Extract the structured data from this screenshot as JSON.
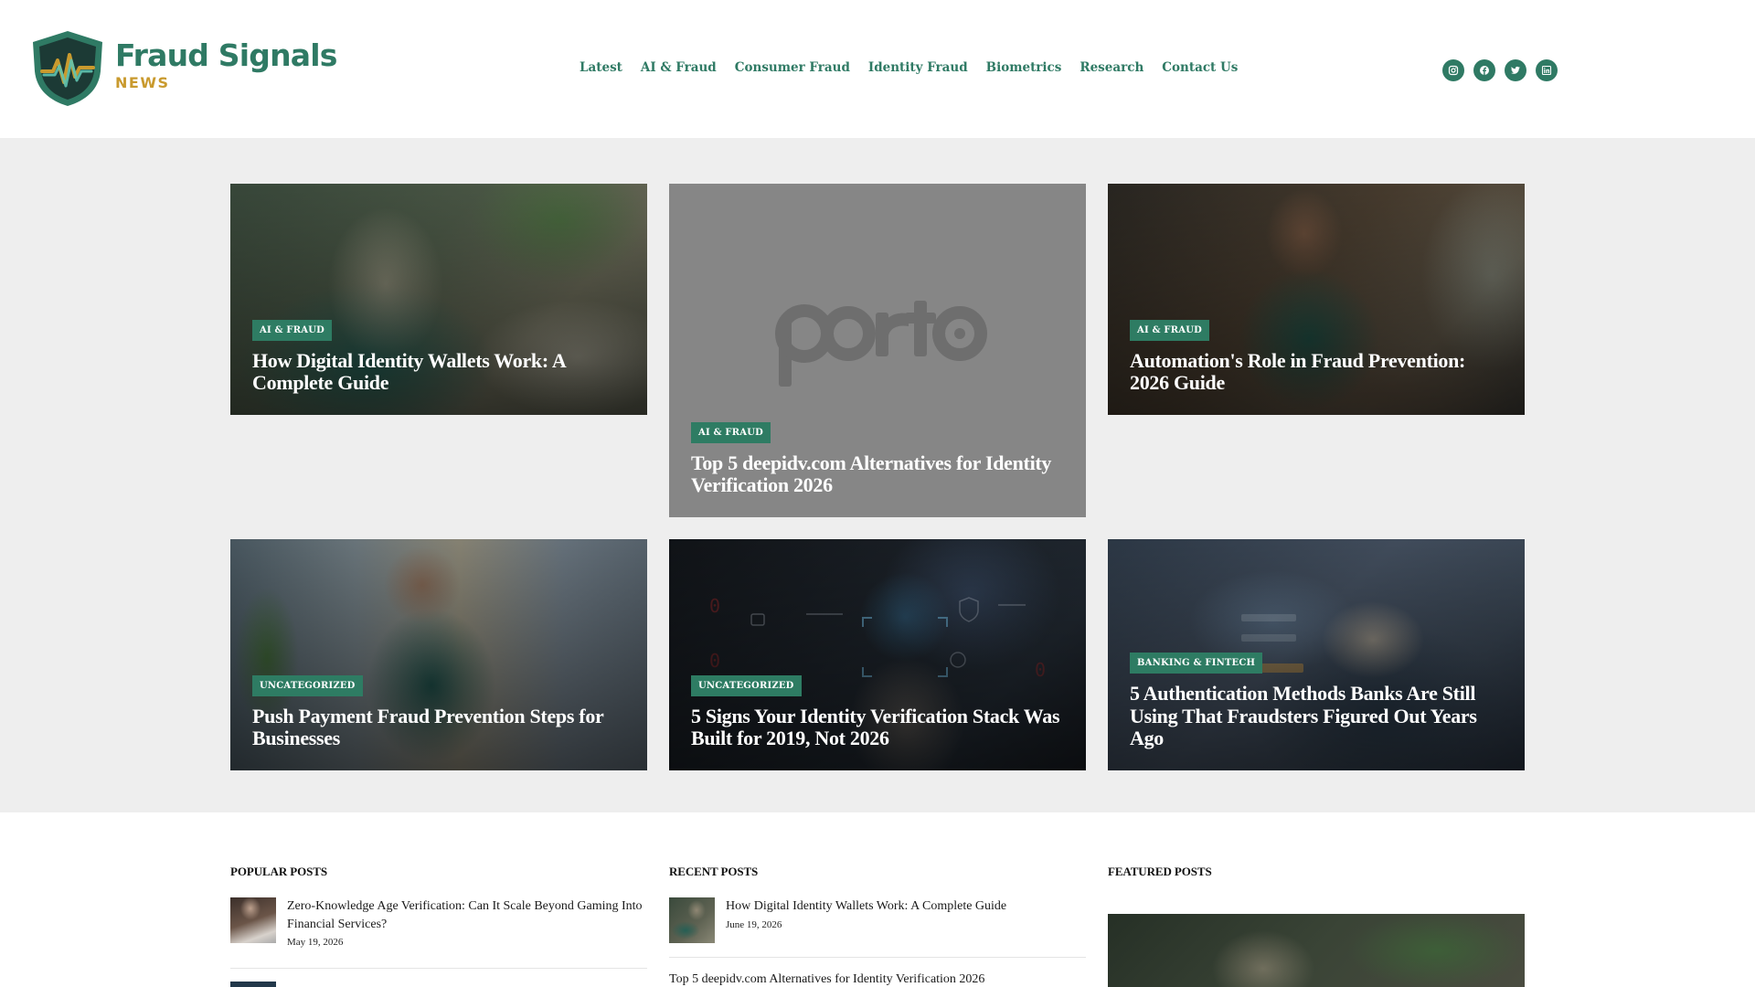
{
  "brand": {
    "name": "Fraud Signals",
    "tagline": "NEWS",
    "primary_color": "#2f7a64",
    "accent_color": "#c99a2e"
  },
  "nav": {
    "items": [
      "Latest",
      "AI & Fraud",
      "Consumer Fraud",
      "Identity Fraud",
      "Biometrics",
      "Research",
      "Contact Us"
    ]
  },
  "social": [
    "instagram-icon",
    "facebook-icon",
    "twitter-icon",
    "linkedin-icon"
  ],
  "hero": {
    "cards": [
      {
        "category": "AI & FRAUD",
        "title": "How Digital Identity Wallets Work: A Complete Guide"
      },
      {
        "category": "AI & FRAUD",
        "title": "Top 5 deepidv.com Alternatives for Identity Verification 2026",
        "placeholder_logo": "porto"
      },
      {
        "category": "AI & FRAUD",
        "title": "Automation's Role in Fraud Prevention: 2026 Guide"
      },
      {
        "category": "UNCATEGORIZED",
        "title": "Push Payment Fraud Prevention Steps for Businesses"
      },
      {
        "category": "UNCATEGORIZED",
        "title": "5 Signs Your Identity Verification Stack Was Built for 2019, Not 2026"
      },
      {
        "category": "BANKING & FINTECH",
        "title": "5 Authentication Methods Banks Are Still Using That Fraudsters Figured Out Years Ago"
      }
    ]
  },
  "popular": {
    "heading": "POPULAR POSTS",
    "items": [
      {
        "title": "Zero-Knowledge Age Verification: Can It Scale Beyond Gaming Into Financial Services?",
        "date": "May 19, 2026"
      }
    ]
  },
  "recent": {
    "heading": "RECENT POSTS",
    "items": [
      {
        "title": "How Digital Identity Wallets Work: A Complete Guide",
        "date": "June 19, 2026"
      },
      {
        "title": "Top 5 deepidv.com Alternatives for Identity Verification 2026"
      }
    ]
  },
  "featured": {
    "heading": "FEATURED POSTS"
  }
}
